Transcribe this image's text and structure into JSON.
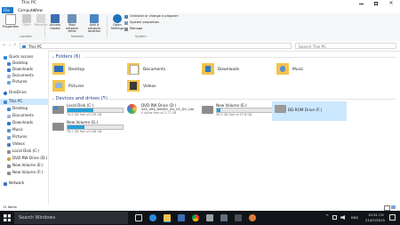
{
  "window": {
    "title": "This PC"
  },
  "menu": {
    "file": "File",
    "computer": "Computer",
    "view": "View"
  },
  "ribbon": {
    "properties": "Properties",
    "open": "Open",
    "rename": "Rename",
    "access_media": "Access media",
    "map_network_drive": "Map network drive",
    "add_network_location": "Add a network location",
    "open_settings": "Open Settings",
    "uninstall": "Uninstall or change a program",
    "system_properties": "System properties",
    "manage": "Manage",
    "group_location": "Location",
    "group_network": "Network",
    "group_system": "System"
  },
  "address": {
    "path": "This PC",
    "search_placeholder": "Search This PC"
  },
  "nav": {
    "items": [
      "Quick access",
      "Desktop",
      "Downloads",
      "Documents",
      "Pictures",
      "OneDrive",
      "This PC",
      "Desktop",
      "Documents",
      "Downloads",
      "Music",
      "Pictures",
      "Videos",
      "Local Disk (C:)",
      "DVD RW Drive (D:)",
      "New Volume (E:)",
      "New Volume (F:)",
      "Network"
    ]
  },
  "folders": {
    "header": "Folders (6)",
    "items": [
      "Desktop",
      "Documents",
      "Downloads",
      "Music",
      "Pictures",
      "Videos"
    ]
  },
  "drives": {
    "header": "Devices and drives (5)",
    "items": [
      {
        "name": "Local Disk (C:)",
        "free": "74.9 GB free of 139 GB",
        "used_fraction": 0.46
      },
      {
        "name": "DVD RW Drive (D:)",
        "sub": "SSS_X64_WINDO_EN_US_DV_Lite",
        "free": "0 bytes free of 2.77 GB"
      },
      {
        "name": "New Volume (E:)",
        "free": "90.5 GB free of 97.6 GB",
        "used_fraction": 0.07
      },
      {
        "name": "BD-ROM Drive (F:)"
      },
      {
        "name": "New Volume (G:)",
        "free": "76.2 GB free of 108 GB",
        "used_fraction": 0.3
      }
    ]
  },
  "status": {
    "items": "11 items"
  },
  "taskbar": {
    "search_placeholder": "Search Windows",
    "lang": "ENG",
    "time": "10:31 CH",
    "date": "21/07/2015"
  },
  "colors": {
    "accent": "#1e3d8a",
    "drive_bar": "#26a0da",
    "folder": "#f3c44d",
    "taskbar": "#101418"
  }
}
